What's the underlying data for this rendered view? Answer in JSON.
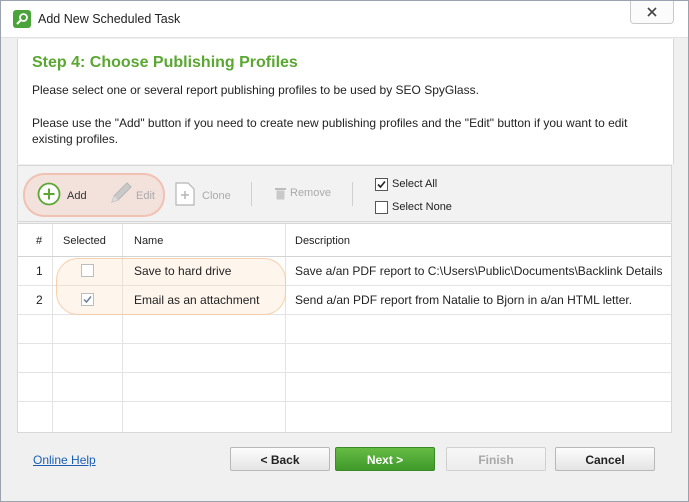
{
  "window": {
    "title": "Add New Scheduled Task"
  },
  "header": {
    "step_title": "Step 4: Choose Publishing Profiles",
    "description_1": "Please select one or several report publishing profiles to be used by SEO SpyGlass.",
    "description_2": "Please use the \"Add\" button if you need to create new publishing profiles and the \"Edit\" button if you want to edit existing profiles."
  },
  "toolbar": {
    "add_label": "Add",
    "edit_label": "Edit",
    "clone_label": "Clone",
    "remove_label": "Remove",
    "select_all_label": "Select All",
    "select_none_label": "Select None",
    "select_all_checked": true,
    "select_none_checked": false
  },
  "table": {
    "columns": [
      "#",
      "Selected",
      "Name",
      "Description"
    ],
    "rows": [
      {
        "num": "1",
        "selected": false,
        "name": "Save to hard drive",
        "description": "Save a/an PDF report to C:\\Users\\Public\\Documents\\Backlink Details"
      },
      {
        "num": "2",
        "selected": true,
        "name": "Email as an attachment",
        "description": "Send a/an PDF report from Natalie  to Bjorn  in a/an HTML letter."
      }
    ]
  },
  "footer": {
    "help_link": "Online Help",
    "back_label": "< Back",
    "next_label": "Next >",
    "finish_label": "Finish",
    "cancel_label": "Cancel"
  },
  "colors": {
    "accent_green": "#5aa732",
    "next_button": "#4aa43a",
    "link_blue": "#1a5fb4"
  },
  "icons": [
    "app-icon",
    "close-icon",
    "add-icon",
    "edit-icon",
    "clone-icon",
    "remove-icon",
    "checkbox-checked-icon"
  ]
}
